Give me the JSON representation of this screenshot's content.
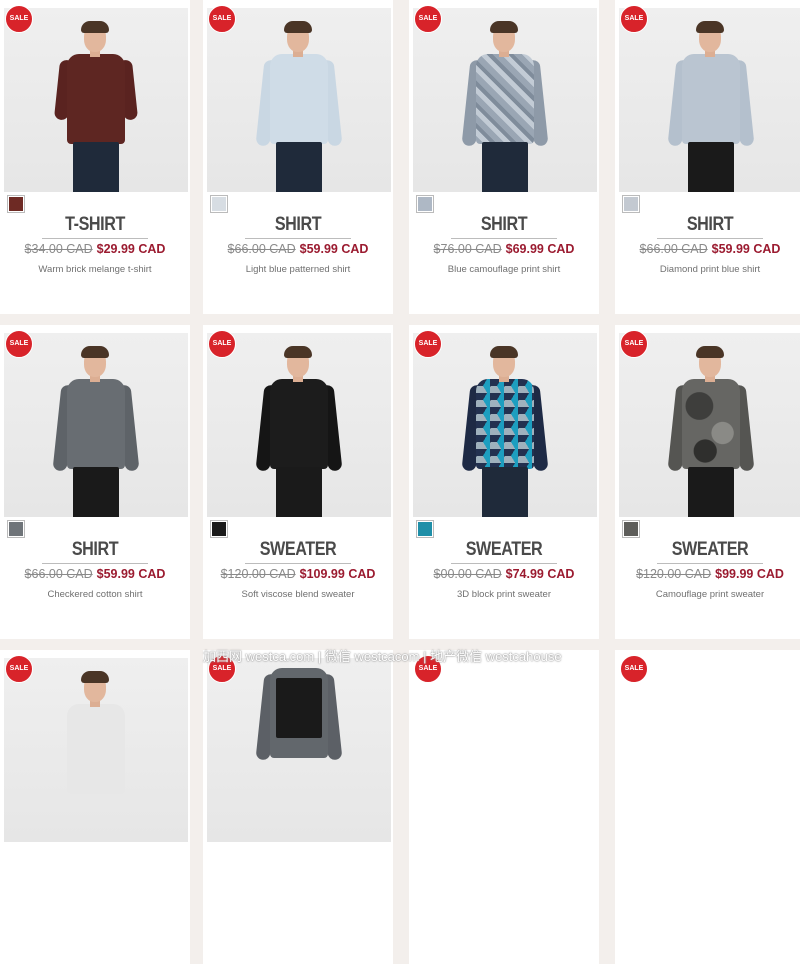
{
  "sale_badge": "SALE",
  "products": [
    {
      "name": "T-SHIRT",
      "old_price": "$34.00 CAD",
      "new_price": "$29.99 CAD",
      "description": "Warm brick melange t-shirt",
      "swatch_color": "#6e2a24"
    },
    {
      "name": "SHIRT",
      "old_price": "$66.00 CAD",
      "new_price": "$59.99 CAD",
      "description": "Light blue patterned shirt",
      "swatch_color": "#d7dde3"
    },
    {
      "name": "SHIRT",
      "old_price": "$76.00 CAD",
      "new_price": "$69.99 CAD",
      "description": "Blue camouflage print shirt",
      "swatch_color": "#aeb8c5"
    },
    {
      "name": "SHIRT",
      "old_price": "$66.00 CAD",
      "new_price": "$59.99 CAD",
      "description": "Diamond print blue shirt",
      "swatch_color": "#c3c9d1"
    },
    {
      "name": "SHIRT",
      "old_price": "$66.00 CAD",
      "new_price": "$59.99 CAD",
      "description": "Checkered cotton shirt",
      "swatch_color": "#6f7479"
    },
    {
      "name": "SWEATER",
      "old_price": "$120.00 CAD",
      "new_price": "$109.99 CAD",
      "description": "Soft viscose blend sweater",
      "swatch_color": "#1a1a1a"
    },
    {
      "name": "SWEATER",
      "old_price": "$00.00 CAD",
      "new_price": "$74.99 CAD",
      "description": "3D block print sweater",
      "swatch_color": "#1f8fa8"
    },
    {
      "name": "SWEATER",
      "old_price": "$120.00 CAD",
      "new_price": "$99.99 CAD",
      "description": "Camouflage print sweater",
      "swatch_color": "#5d5d5a"
    }
  ],
  "watermark": "加西网 westca.com | 微信 westcacom | 地产微信 westcahouse"
}
